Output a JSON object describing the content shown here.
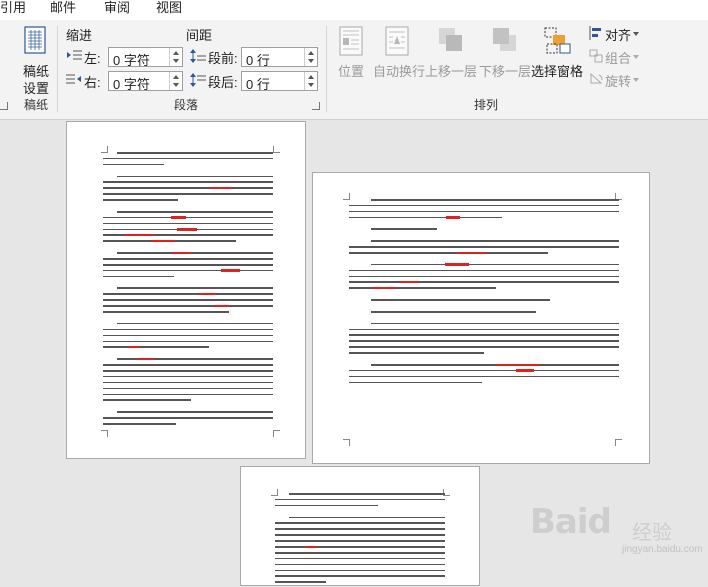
{
  "menu": {
    "items": [
      "引用",
      "邮件",
      "审阅",
      "视图"
    ]
  },
  "ribbon": {
    "manuscript": {
      "button_label_1": "稿纸",
      "button_label_2": "设置",
      "group_label": "稿纸"
    },
    "paragraph": {
      "indent_header": "缩进",
      "spacing_header": "间距",
      "left_label": "左:",
      "right_label": "右:",
      "left_value": "0 字符",
      "right_value": "0 字符",
      "before_label": "段前:",
      "after_label": "段后:",
      "before_value": "0 行",
      "after_value": "0 行",
      "group_label": "段落"
    },
    "arrange": {
      "position_label": "位置",
      "wrap_text_label": "自动换行",
      "bring_forward_label": "上移一层",
      "send_backward_label": "下移一层",
      "selection_pane_label": "选择窗格",
      "align_label": "对齐",
      "group_objects_label": "组合",
      "rotate_label": "旋转",
      "group_label": "排列"
    }
  },
  "watermark": {
    "brand": "Baid",
    "sub": "经验",
    "url": "jingyan.baidu.com"
  },
  "colors": {
    "ribbon_bg": "#f3f3f3",
    "canvas_bg": "#e6e6e6",
    "squiggle": "#dd2222",
    "icon_blue": "#2b579a"
  }
}
